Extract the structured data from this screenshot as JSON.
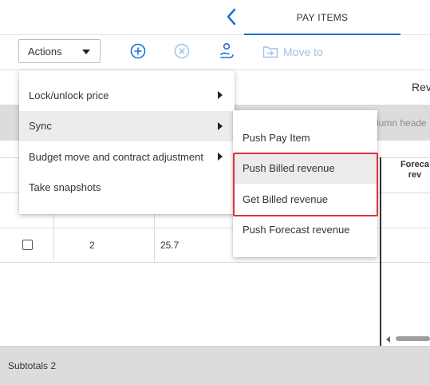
{
  "header": {
    "active_tab": "PAY ITEMS"
  },
  "toolbar": {
    "actions_label": "Actions",
    "move_to_label": "Move to"
  },
  "grid": {
    "group_header": "Rev",
    "gray_band_text": "lumn heade",
    "forecast_header_line1": "Foreca",
    "forecast_header_line2": "rev",
    "row_number": "2",
    "row_value": "25.7",
    "subtotals_label": "Subtotals 2"
  },
  "actions_menu": {
    "items": [
      {
        "label": "Lock/unlock price",
        "has_submenu": true
      },
      {
        "label": "Sync",
        "has_submenu": true
      },
      {
        "label": "Budget move and contract adjustment",
        "has_submenu": true
      },
      {
        "label": "Take snapshots",
        "has_submenu": false
      }
    ]
  },
  "sync_submenu": {
    "items": [
      {
        "label": "Push Pay Item"
      },
      {
        "label": "Push Billed revenue"
      },
      {
        "label": "Get Billed revenue"
      },
      {
        "label": "Push Forecast revenue"
      }
    ]
  },
  "colors": {
    "accent": "#1f6fd1",
    "disabled_icon": "#9fc3ea",
    "highlight": "#e0313b",
    "band_gray": "#dcdcdc"
  }
}
